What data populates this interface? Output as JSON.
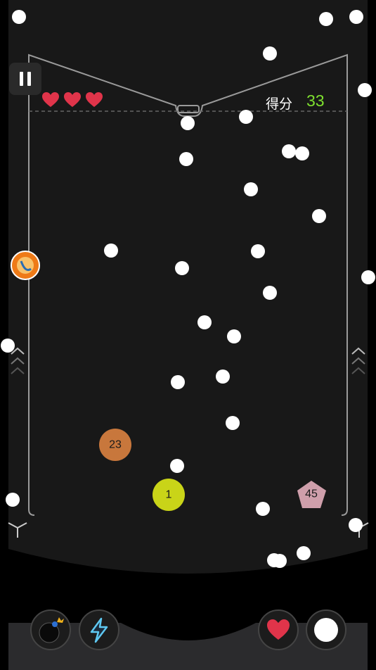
{
  "hud": {
    "score_label": "得分",
    "score_value": "33",
    "lives": 3
  },
  "blocks": [
    {
      "label": "23",
      "shape": "circle",
      "color": "#c8773c"
    },
    {
      "label": "1",
      "shape": "circle",
      "color": "#c9d418"
    },
    {
      "label": "45",
      "shape": "pentagon",
      "color": "#cf9fab"
    }
  ],
  "powerups": [
    {
      "name": "bomb"
    },
    {
      "name": "lightning"
    },
    {
      "name": "extra-life"
    },
    {
      "name": "extra-ball"
    }
  ],
  "colors": {
    "score": "#7ee02f",
    "heart": "#e0344a",
    "ball": "#ffffff",
    "frame": "#9a9a9a"
  }
}
